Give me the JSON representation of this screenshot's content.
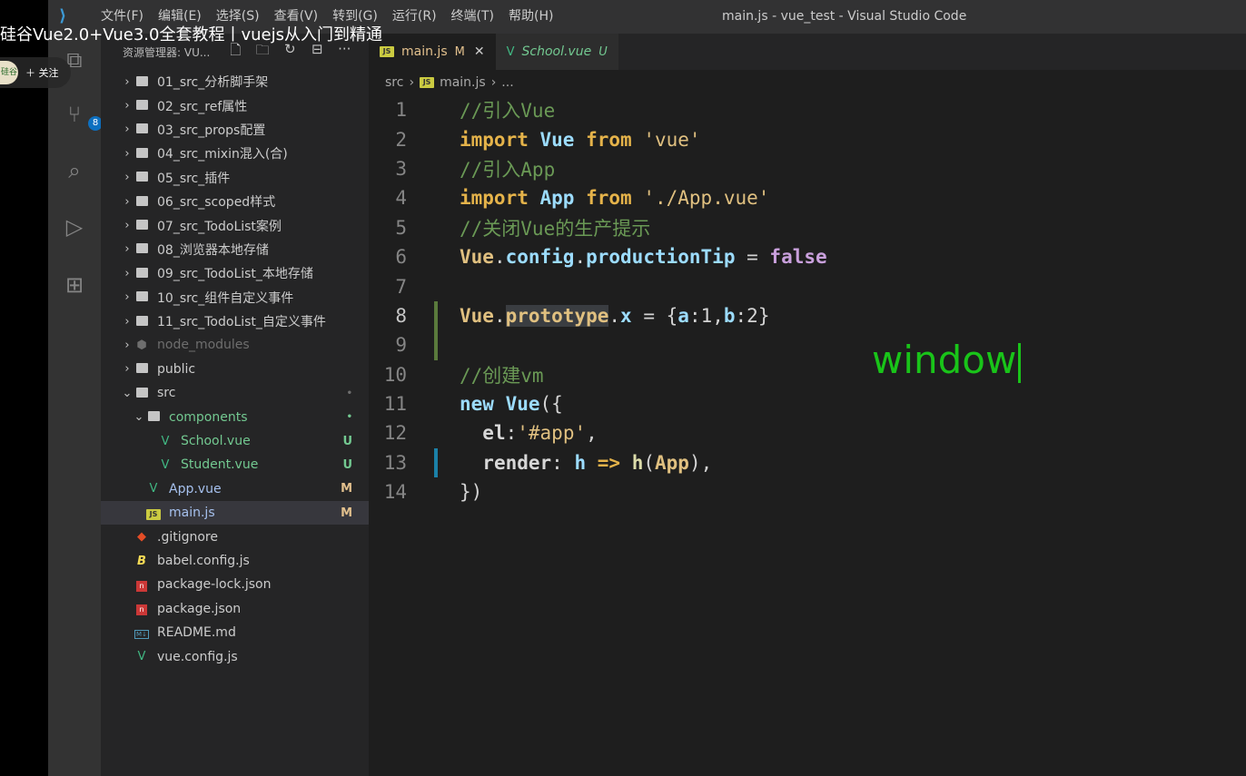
{
  "video": {
    "title": "硅谷Vue2.0+Vue3.0全套教程丨vuejs从入门到精通",
    "follow_label": "＋ 关注",
    "avatar_text": "硅谷"
  },
  "titlebar": {
    "menu": [
      "文件(F)",
      "编辑(E)",
      "选择(S)",
      "查看(V)",
      "转到(G)",
      "运行(R)",
      "终端(T)",
      "帮助(H)"
    ],
    "window_title": "main.js - vue_test - Visual Studio Code"
  },
  "activitybar": {
    "scm_badge": "8"
  },
  "sidebar": {
    "title": "资源管理器: VU...",
    "tree": [
      {
        "label": "01_src_分析脚手架",
        "type": "folder",
        "depth": 0
      },
      {
        "label": "02_src_ref属性",
        "type": "folder",
        "depth": 0
      },
      {
        "label": "03_src_props配置",
        "type": "folder",
        "depth": 0
      },
      {
        "label": "04_src_mixin混入(合)",
        "type": "folder",
        "depth": 0
      },
      {
        "label": "05_src_插件",
        "type": "folder",
        "depth": 0
      },
      {
        "label": "06_src_scoped样式",
        "type": "folder",
        "depth": 0
      },
      {
        "label": "07_src_TodoList案例",
        "type": "folder",
        "depth": 0
      },
      {
        "label": "08_浏览器本地存储",
        "type": "folder",
        "depth": 0
      },
      {
        "label": "09_src_TodoList_本地存储",
        "type": "folder",
        "depth": 0
      },
      {
        "label": "10_src_组件自定义事件",
        "type": "folder",
        "depth": 0
      },
      {
        "label": "11_src_TodoList_自定义事件",
        "type": "folder",
        "depth": 0
      },
      {
        "label": "node_modules",
        "type": "node",
        "depth": 0
      },
      {
        "label": "public",
        "type": "folder",
        "depth": 0
      },
      {
        "label": "src",
        "type": "folder-open",
        "depth": 0,
        "status": "•"
      },
      {
        "label": "components",
        "type": "folder-open",
        "depth": 1,
        "status": "•"
      },
      {
        "label": "School.vue",
        "type": "vue",
        "depth": 2,
        "status": "U"
      },
      {
        "label": "Student.vue",
        "type": "vue",
        "depth": 2,
        "status": "U"
      },
      {
        "label": "App.vue",
        "type": "vue",
        "depth": 1,
        "status": "M"
      },
      {
        "label": "main.js",
        "type": "js",
        "depth": 1,
        "status": "M"
      },
      {
        "label": ".gitignore",
        "type": "git",
        "depth": 0
      },
      {
        "label": "babel.config.js",
        "type": "babel",
        "depth": 0
      },
      {
        "label": "package-lock.json",
        "type": "json",
        "depth": 0
      },
      {
        "label": "package.json",
        "type": "json",
        "depth": 0
      },
      {
        "label": "README.md",
        "type": "md",
        "depth": 0
      },
      {
        "label": "vue.config.js",
        "type": "vue",
        "depth": 0
      }
    ]
  },
  "editor": {
    "tabs": [
      {
        "icon": "JS",
        "name": "main.js",
        "flag": "M",
        "close": "✕"
      },
      {
        "icon": "V",
        "name": "School.vue",
        "flag": "U"
      }
    ],
    "breadcrumb": {
      "folder": "src",
      "sep": "›",
      "file": "main.js",
      "tail": "..."
    },
    "lines": [
      "1",
      "2",
      "3",
      "4",
      "5",
      "6",
      "7",
      "8",
      "9",
      "10",
      "11",
      "12",
      "13",
      "14"
    ],
    "code": {
      "l1": "//引入Vue",
      "l2_kw": "import",
      "l2_id": "Vue",
      "l2_from": "from",
      "l2_str": "'vue'",
      "l3": "//引入App",
      "l4_kw": "import",
      "l4_id": "App",
      "l4_from": "from",
      "l4_str": "'./App.vue'",
      "l5": "//关闭Vue的生产提示",
      "l6_a": "Vue",
      "l6_b": ".",
      "l6_c": "config",
      "l6_d": ".",
      "l6_e": "productionTip",
      "l6_f": " = ",
      "l6_g": "false",
      "l8_a": "Vue",
      "l8_b": ".",
      "l8_c": "prototype",
      "l8_d": ".",
      "l8_e": "x",
      "l8_f": " = {",
      "l8_g": "a",
      "l8_h": ":1,",
      "l8_i": "b",
      "l8_j": ":2}",
      "l10": "//创建vm",
      "l11_kw": "new",
      "l11_cls": "Vue",
      "l11_rest": "({",
      "l12_key": "el",
      "l12_colon": ":",
      "l12_str": "'#app'",
      "l12_comma": ",",
      "l13_key": "render",
      "l13_colon": ": ",
      "l13_h": "h",
      "l13_arrow": " => ",
      "l13_fn": "h",
      "l13_rest1": "(",
      "l13_app": "App",
      "l13_rest2": "),",
      "l14": "})"
    }
  },
  "annotation": "window"
}
